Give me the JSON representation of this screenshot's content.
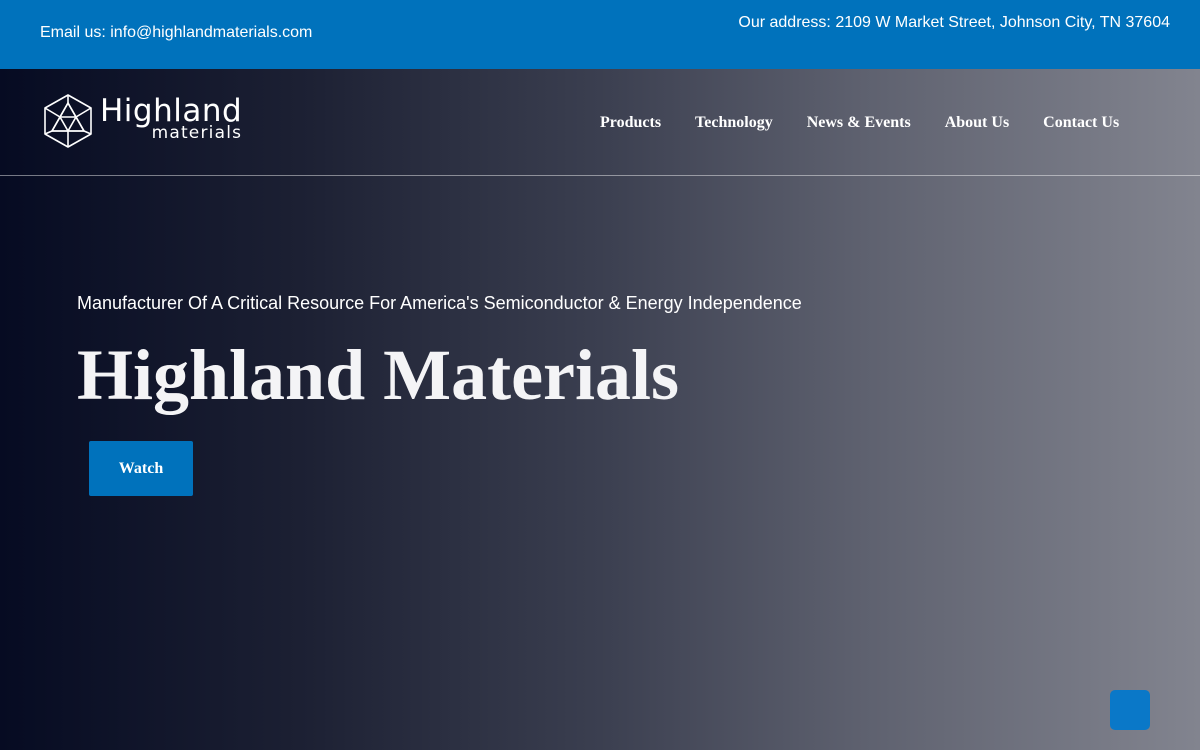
{
  "topbar": {
    "email": "Email us: info@highlandmaterials.com",
    "address": "Our address: 2109 W Market Street, Johnson City, TN 37604"
  },
  "logo": {
    "word_top": "Highland",
    "word_bottom": "materials",
    "icon": "hexagon-triangles-icon"
  },
  "nav": {
    "items": [
      {
        "label": "Products"
      },
      {
        "label": "Technology"
      },
      {
        "label": "News & Events"
      },
      {
        "label": "About Us"
      },
      {
        "label": "Contact Us"
      }
    ]
  },
  "hero": {
    "subtitle": "Manufacturer Of A Critical Resource For America's Semiconductor & Energy Independence",
    "title": "Highland Materials",
    "watch_label": "Watch"
  },
  "colors": {
    "brand_blue": "#0072bc",
    "scroll_button": "#0a78c8"
  }
}
